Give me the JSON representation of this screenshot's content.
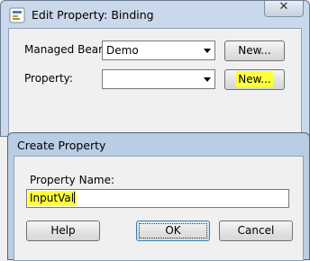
{
  "edit_property_window": {
    "title": "Edit Property: Binding",
    "close_glyph": "✕",
    "managed_bean_label": "Managed Bean:",
    "managed_bean_value": "Demo",
    "new_bean_button": "New...",
    "property_label": "Property:",
    "property_value": "",
    "new_property_button": "New..."
  },
  "create_property_dialog": {
    "title": "Create Property",
    "property_name_label": "Property Name:",
    "property_name_value": "InputVal",
    "help_button": "Help",
    "ok_button": "OK",
    "cancel_button": "Cancel"
  },
  "colors": {
    "highlight": "#ffff3a",
    "title_bar": "#c9d8ea",
    "dialog_title_bar": "#b9cde4",
    "panel": "#f0f0f0"
  },
  "icons": [
    "app-icon",
    "close-icon",
    "dropdown-arrow-icon"
  ]
}
